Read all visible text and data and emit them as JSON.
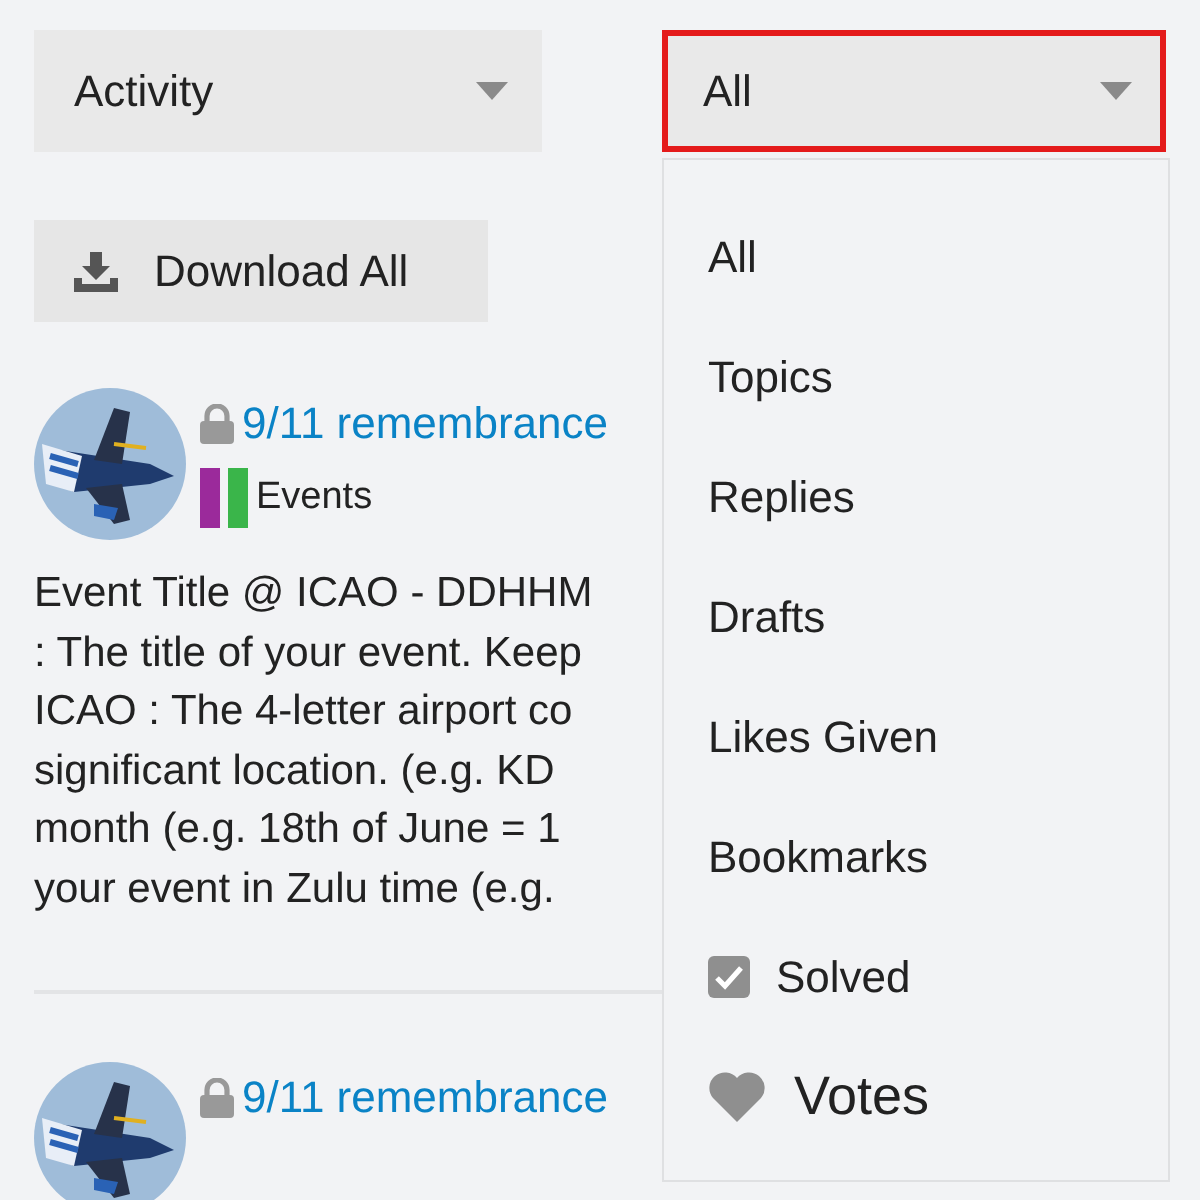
{
  "filters": [
    {
      "value": "Activity",
      "focused": false
    },
    {
      "value": "All",
      "focused": true
    }
  ],
  "download_button": {
    "label": "Download All"
  },
  "posts": [
    {
      "title": "9/11 remembrance",
      "locked": true,
      "category": {
        "name": "Events",
        "color": "#9b2a9b"
      },
      "body_lines": [
        "Event Title @ ICAO - DDHHM",
        ": The title of your event. Keep",
        "ICAO : The 4-letter airport co",
        "significant location. (e.g. KD",
        "month (e.g. 18th of June = 1",
        "your event in Zulu time (e.g."
      ]
    },
    {
      "title": "9/11 remembrance",
      "locked": true
    }
  ],
  "dropdown_menu": {
    "items": [
      {
        "kind": "text",
        "label": "All"
      },
      {
        "kind": "text",
        "label": "Topics"
      },
      {
        "kind": "text",
        "label": "Replies"
      },
      {
        "kind": "text",
        "label": "Drafts"
      },
      {
        "kind": "text",
        "label": "Likes Given"
      },
      {
        "kind": "text",
        "label": "Bookmarks"
      },
      {
        "kind": "check",
        "label": "Solved"
      },
      {
        "kind": "heart",
        "label": "Votes"
      }
    ]
  }
}
